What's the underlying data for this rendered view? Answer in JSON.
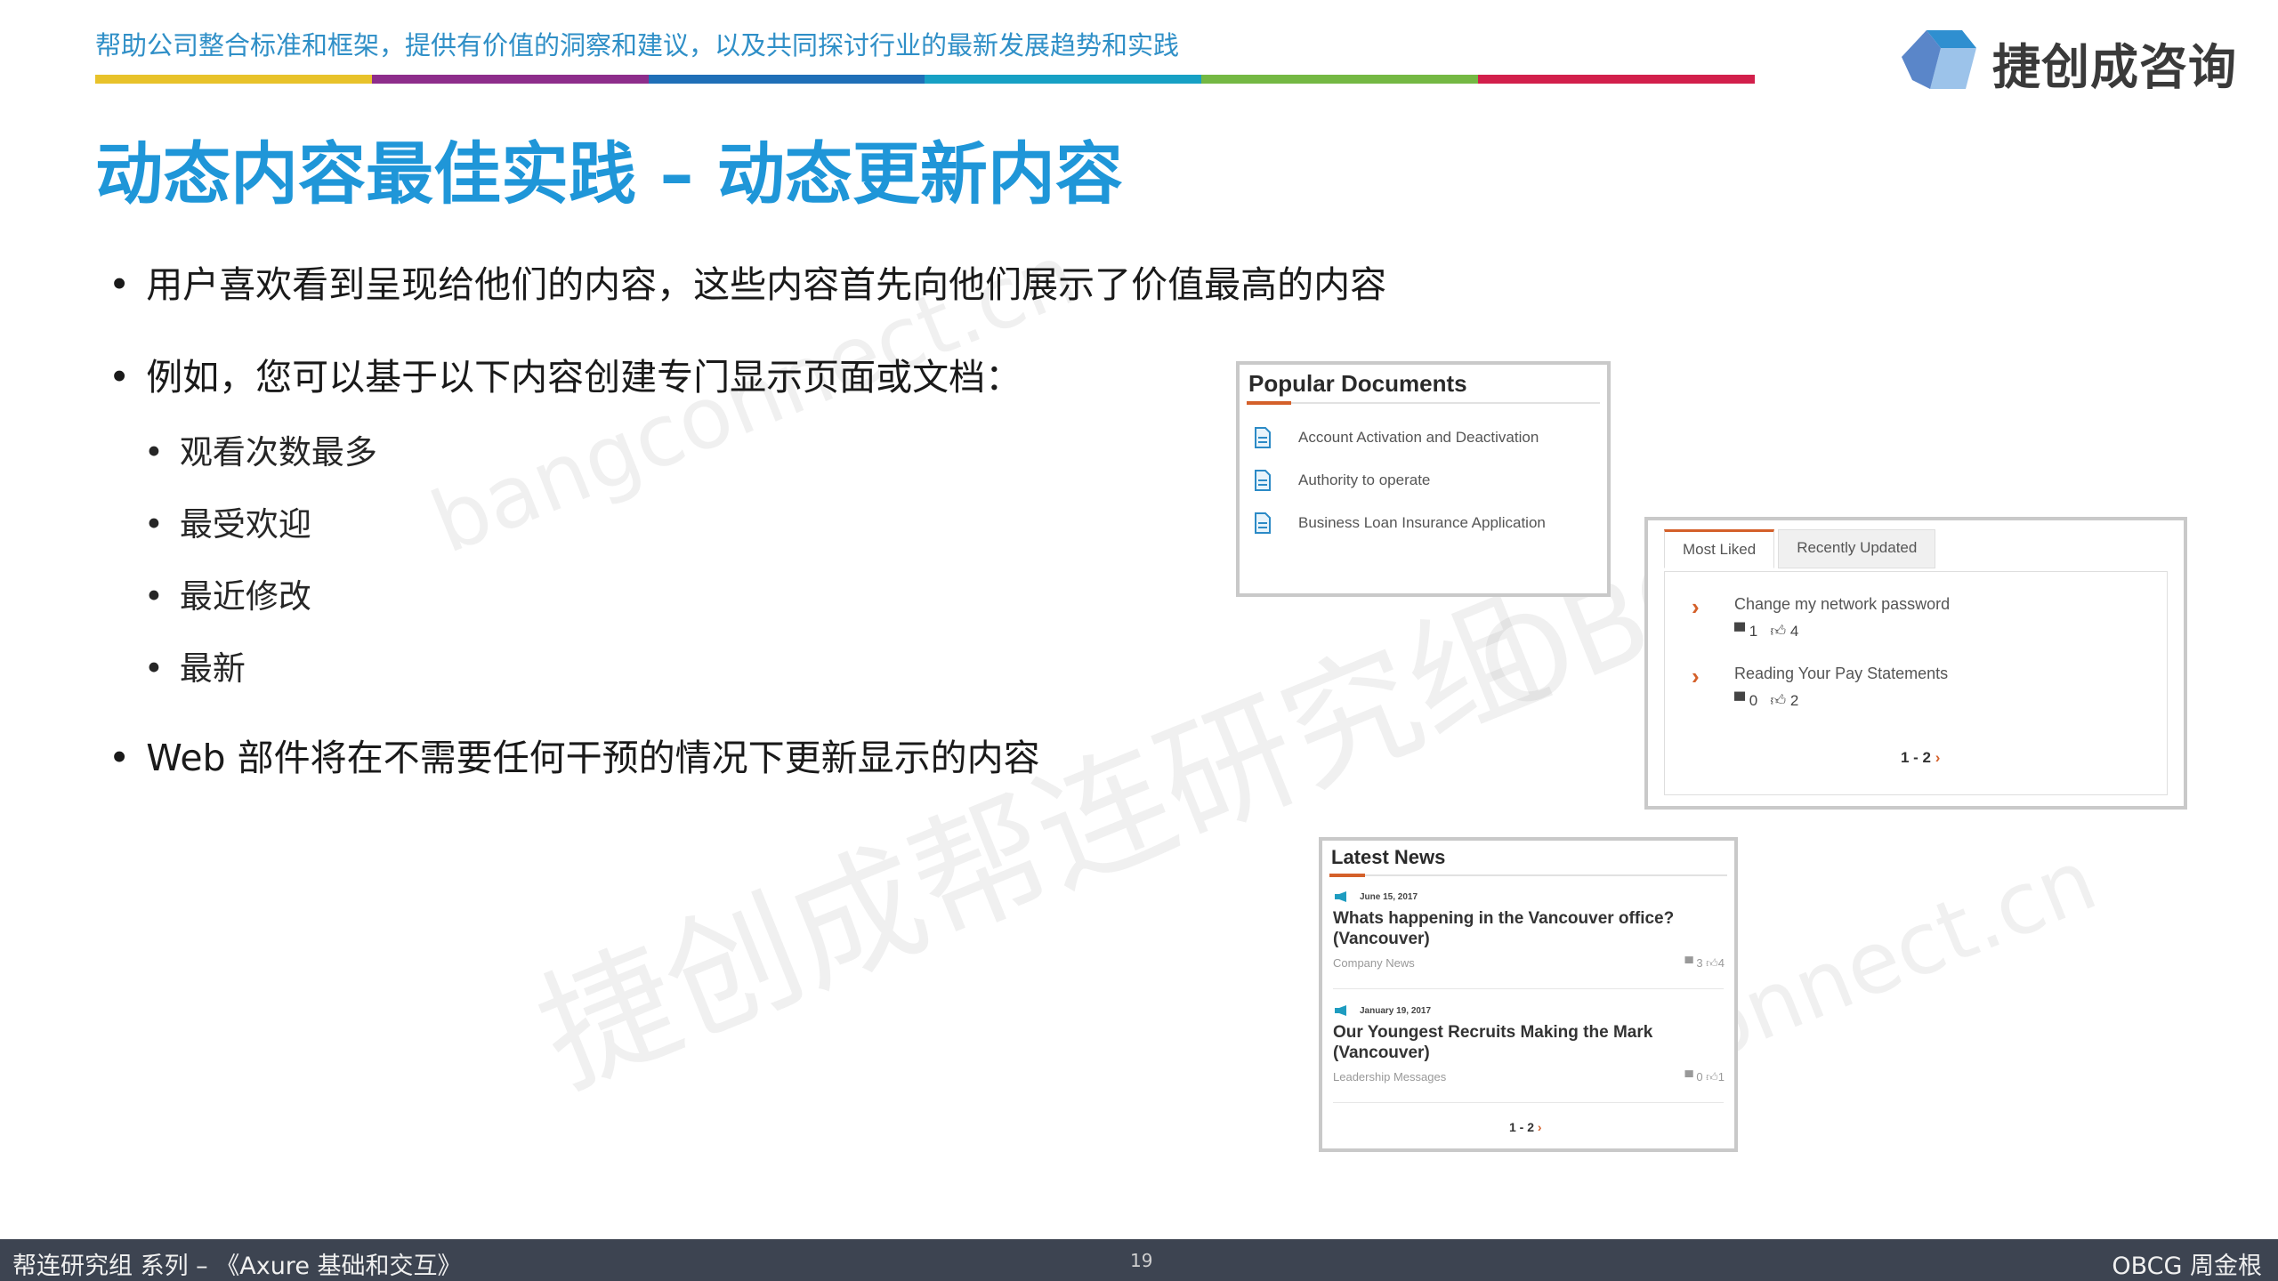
{
  "header": {
    "tagline": "帮助公司整合标准和框架，提供有价值的洞察和建议，以及共同探讨行业的最新发展趋势和实践",
    "logo_text": "捷创成咨询",
    "bar_colors": [
      "#e8c22a",
      "#8d2d8b",
      "#1f6fb7",
      "#17a0c4",
      "#74b843",
      "#d21f4b"
    ]
  },
  "title": "动态内容最佳实践 – 动态更新内容",
  "bullets": {
    "b1": "用户喜欢看到呈现给他们的内容，这些内容首先向他们展示了价值最高的内容",
    "b2": "例如，您可以基于以下内容创建专门显示页面或文档：",
    "sub": [
      "观看次数最多",
      "最受欢迎",
      "最近修改",
      "最新"
    ],
    "b3": "Web 部件将在不需要任何干预的情况下更新显示的内容"
  },
  "watermarks": {
    "w1": "bangconnect.cn",
    "w2": "捷创成帮连研究组",
    "w3": "OBCG",
    "w4": "connect.cn"
  },
  "popular_documents": {
    "title": "Popular Documents",
    "items": [
      "Account Activation and Deactivation",
      "Authority to operate",
      "Business Loan Insurance Application"
    ]
  },
  "liked_widget": {
    "tabs": [
      "Most Liked",
      "Recently Updated"
    ],
    "items": [
      {
        "title": "Change my network password",
        "comments": "1",
        "likes": "4"
      },
      {
        "title": "Reading Your Pay Statements",
        "comments": "0",
        "likes": "2"
      }
    ],
    "pager": "1 - 2"
  },
  "latest_news": {
    "title": "Latest News",
    "items": [
      {
        "date": "June 15, 2017",
        "headline": "Whats happening in the Vancouver office? (Vancouver)",
        "category": "Company News",
        "comments": "3",
        "likes": "4"
      },
      {
        "date": "January 19, 2017",
        "headline": "Our Youngest Recruits Making the Mark (Vancouver)",
        "category": "Leadership Messages",
        "comments": "0",
        "likes": "1"
      }
    ],
    "pager": "1 - 2"
  },
  "footer": {
    "left": "帮连研究组 系列 – 《Axure 基础和交互》",
    "page": "19",
    "right": "OBCG 周金根"
  }
}
